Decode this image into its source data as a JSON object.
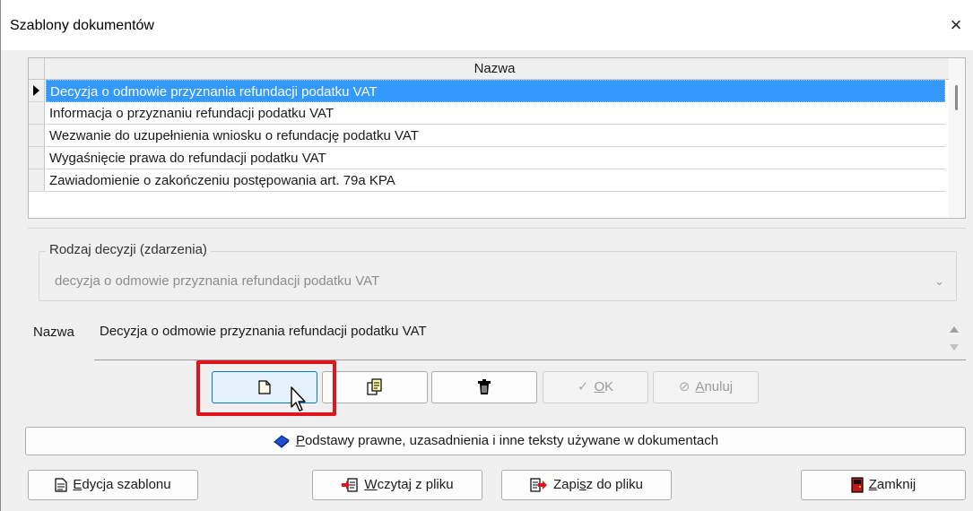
{
  "window": {
    "title": "Szablony dokumentów",
    "close_glyph": "×"
  },
  "grid": {
    "column_header": "Nazwa",
    "rows": [
      "Decyzja o odmowie przyznania refundacji podatku VAT",
      "Informacja o przyznaniu refundacji podatku VAT",
      "Wezwanie do uzupełnienia wniosku o refundację podatku VAT",
      "Wygaśnięcie prawa do refundacji podatku VAT",
      "Zawiadomienie o zakończeniu postępowania art. 79a KPA"
    ],
    "selected_index": 0
  },
  "group": {
    "label": "Rodzaj decyzji (zdarzenia)",
    "combo_value": "decyzja o odmowie przyznania refundacji podatku VAT"
  },
  "nazwa": {
    "label": "Nazwa",
    "value": "Decyzja o odmowie przyznania refundacji podatku VAT"
  },
  "toolbar": {
    "new_icon": "new-document-icon",
    "copy_icon": "copy-document-icon",
    "delete_icon": "trash-icon",
    "ok_prefix": "",
    "ok_underlined": "O",
    "ok_rest": "K",
    "cancel_underlined": "A",
    "cancel_rest": "nuluj"
  },
  "wide_button": {
    "icon": "book-icon",
    "underlined": "P",
    "rest": "odstawy prawne, uzasadnienia i inne teksty używane w dokumentach"
  },
  "bottom": {
    "edit": {
      "underlined": "E",
      "rest": "dycja szablonu"
    },
    "load": {
      "underlined": "W",
      "rest": "czytaj z pliku"
    },
    "save": {
      "prefix": "Zapi",
      "underlined": "s",
      "rest": "z do pliku"
    },
    "close": {
      "underlined": "Z",
      "rest": "amknij"
    }
  },
  "colors": {
    "selection": "#3399ff",
    "highlight_frame": "#e0151b",
    "hot_button": "#e5f1fb"
  }
}
